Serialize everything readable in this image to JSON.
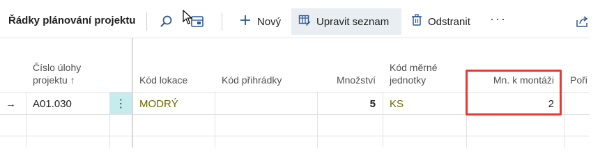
{
  "header": {
    "title": "Řádky plánování projektu",
    "search_icon": "search-icon",
    "layout_icon": "layout-icon",
    "new_label": "Nový",
    "edit_list_label": "Upravit seznam",
    "delete_label": "Odstranit",
    "more_label": "···",
    "share_icon": "share-icon"
  },
  "columns": {
    "task_number": "Číslo úlohy projektu",
    "task_sort_arrow": "↑",
    "location_code": "Kód lokace",
    "bin_code": "Kód přihrádky",
    "quantity": "Množství",
    "uom_code": "Kód měrné jednotky",
    "qty_to_assemble": "Mn. k montáži",
    "next_truncated": "Poři"
  },
  "rows": [
    {
      "indicator": "→",
      "task_number": "A01.030",
      "location_code": "MODRÝ",
      "bin_code": "",
      "quantity": "5",
      "uom_code": "KS",
      "qty_to_assemble": "2"
    }
  ],
  "colors": {
    "accent_highlight": "#e53935",
    "link_text": "#6b6b00",
    "row_action_bg": "#c7ecee"
  }
}
